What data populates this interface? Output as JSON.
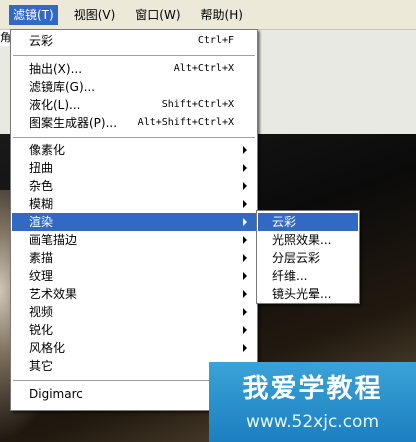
{
  "menubar": {
    "items": [
      {
        "label": "滤镜(T)",
        "active": true
      },
      {
        "label": "视图(V)"
      },
      {
        "label": "窗口(W)"
      },
      {
        "label": "帮助(H)"
      }
    ]
  },
  "filter_menu": {
    "top": {
      "label": "云彩",
      "shortcut": "Ctrl+F"
    },
    "group1": [
      {
        "label": "抽出(X)...",
        "shortcut": "Alt+Ctrl+X"
      },
      {
        "label": "滤镜库(G)..."
      },
      {
        "label": "液化(L)...",
        "shortcut": "Shift+Ctrl+X"
      },
      {
        "label": "图案生成器(P)...",
        "shortcut": "Alt+Shift+Ctrl+X"
      }
    ],
    "group2": [
      "像素化",
      "扭曲",
      "杂色",
      "模糊",
      "渲染",
      "画笔描边",
      "素描",
      "纹理",
      "艺术效果",
      "视频",
      "锐化",
      "风格化",
      "其它"
    ],
    "bottom": {
      "label": "Digimarc"
    }
  },
  "render_submenu": [
    "云彩",
    "光照效果...",
    "分层云彩",
    "纤维...",
    "镜头光晕..."
  ],
  "watermark": {
    "title": "我爱学教程",
    "url": "www.52xjc.com"
  },
  "background": {
    "cut_text": "角"
  },
  "colors": {
    "highlight": "#316ac5",
    "menubar": "#ece9d8",
    "watermark": "#2a93cf"
  }
}
